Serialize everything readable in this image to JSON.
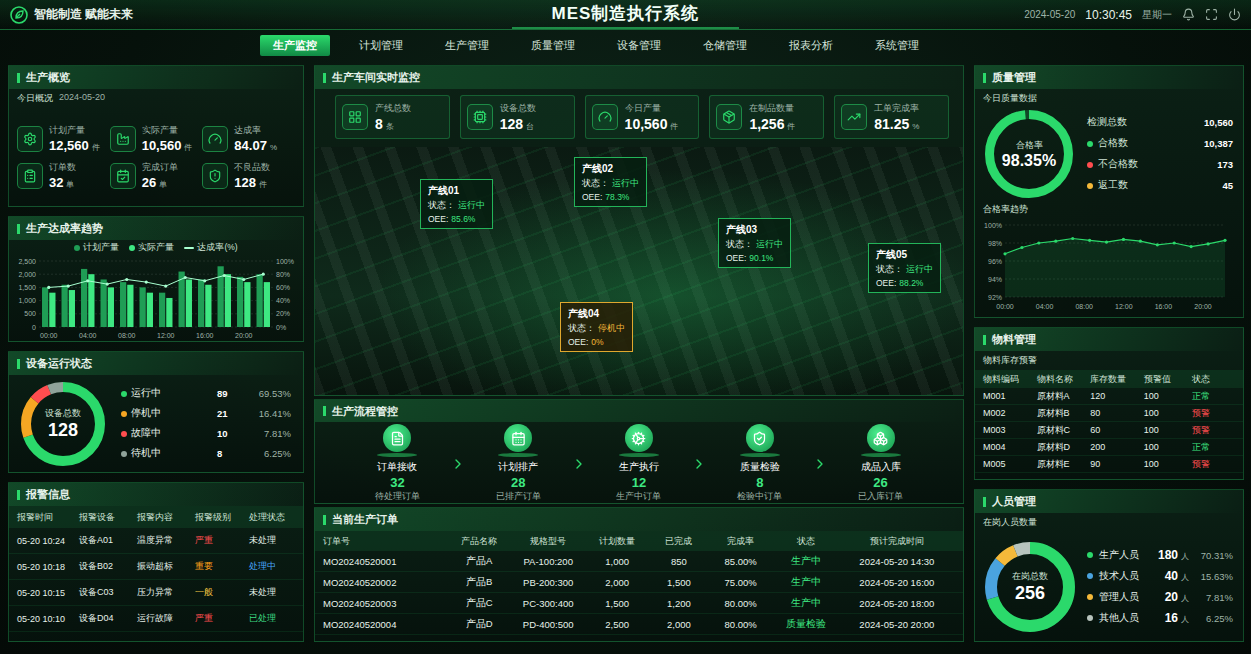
{
  "header": {
    "logo": "智能制造 赋能未来",
    "title": "MES制造执行系统",
    "date": "2024-05-20",
    "time": "10:30:45",
    "weekday": "星期一"
  },
  "nav": [
    {
      "label": "生产监控",
      "selected": true
    },
    {
      "label": "计划管理",
      "selected": false
    },
    {
      "label": "生产管理",
      "selected": false
    },
    {
      "label": "质量管理",
      "selected": false
    },
    {
      "label": "设备管理",
      "selected": false
    },
    {
      "label": "仓储管理",
      "selected": false
    },
    {
      "label": "报表分析",
      "selected": false
    },
    {
      "label": "系统管理",
      "selected": false
    }
  ],
  "overview": {
    "title": "生产概览",
    "subtitle": "今日概况",
    "date": "2024-05-20",
    "stats": [
      {
        "label": "计划产量",
        "value": "12,560",
        "unit": "件"
      },
      {
        "label": "实际产量",
        "value": "10,560",
        "unit": "件"
      },
      {
        "label": "达成率",
        "value": "84.07",
        "unit": "%"
      },
      {
        "label": "订单数",
        "value": "32",
        "unit": "单"
      },
      {
        "label": "完成订单",
        "value": "26",
        "unit": "单"
      },
      {
        "label": "不良品数",
        "value": "128",
        "unit": "件"
      }
    ]
  },
  "trend": {
    "title": "生产达成率趋势",
    "legend": [
      {
        "label": "计划产量",
        "color": "#1f9d55",
        "kind": "bar"
      },
      {
        "label": "实际产量",
        "color": "#3ee882",
        "kind": "bar"
      },
      {
        "label": "达成率(%)",
        "color": "#a8ffd0",
        "kind": "line"
      }
    ],
    "left_ticks": [
      "2,500",
      "2,000",
      "1,500",
      "1,000",
      "500",
      "0"
    ],
    "right_ticks": [
      "100%",
      "80%",
      "60%",
      "40%",
      "20%",
      "0%"
    ],
    "x_ticks": [
      "00:00",
      "04:00",
      "08:00",
      "12:00",
      "16:00",
      "20:00"
    ],
    "plan": [
      1500,
      1600,
      2200,
      1800,
      1700,
      1500,
      1300,
      2100,
      1800,
      2300,
      1900,
      2000
    ],
    "actual": [
      1300,
      1400,
      2000,
      1500,
      1600,
      1300,
      1100,
      1800,
      1600,
      2000,
      1700,
      1700
    ],
    "rate": [
      60,
      62,
      70,
      65,
      72,
      68,
      62,
      75,
      70,
      78,
      72,
      80
    ]
  },
  "equipment": {
    "title": "设备运行状态",
    "center_label": "设备总数",
    "total": "128",
    "items": [
      {
        "label": "运行中",
        "count": "89",
        "percent": "69.53%",
        "color": "#2bd96b"
      },
      {
        "label": "停机中",
        "count": "21",
        "percent": "16.41%",
        "color": "#f5a623"
      },
      {
        "label": "故障中",
        "count": "10",
        "percent": "7.81%",
        "color": "#ff4d4f"
      },
      {
        "label": "待机中",
        "count": "8",
        "percent": "6.25%",
        "color": "#8fa39a"
      }
    ]
  },
  "alarms": {
    "title": "报警信息",
    "columns": [
      "报警时间",
      "报警设备",
      "报警内容",
      "报警级别",
      "处理状态"
    ],
    "rows": [
      {
        "time": "05-20 10:24",
        "device": "设备A01",
        "content": "温度异常",
        "level": "严重",
        "level_color": "#ff4d4f",
        "status": "未处理",
        "status_color": "#e6f2ea"
      },
      {
        "time": "05-20 10:18",
        "device": "设备B02",
        "content": "振动超标",
        "level": "重要",
        "level_color": "#ff9f1a",
        "status": "处理中",
        "status_color": "#4aa8ff"
      },
      {
        "time": "05-20 10:15",
        "device": "设备C03",
        "content": "压力异常",
        "level": "一般",
        "level_color": "#f5c542",
        "status": "未处理",
        "status_color": "#e6f2ea"
      },
      {
        "time": "05-20 10:10",
        "device": "设备D04",
        "content": "运行故障",
        "level": "严重",
        "level_color": "#ff4d4f",
        "status": "已处理",
        "status_color": "#3ddc84"
      }
    ]
  },
  "monitor": {
    "title": "生产车间实时监控",
    "kpis": [
      {
        "label": "产线总数",
        "value": "8",
        "unit": "条"
      },
      {
        "label": "设备总数",
        "value": "128",
        "unit": "台"
      },
      {
        "label": "今日产量",
        "value": "10,560",
        "unit": "件"
      },
      {
        "label": "在制品数量",
        "value": "1,256",
        "unit": "件"
      },
      {
        "label": "工单完成率",
        "value": "81.25",
        "unit": "%"
      }
    ],
    "status_label": "状态：",
    "oee_label": "OEE:",
    "lines": [
      {
        "name": "产线01",
        "status": "运行中",
        "oee": "85.6%",
        "running": true
      },
      {
        "name": "产线02",
        "status": "运行中",
        "oee": "78.3%",
        "running": true
      },
      {
        "name": "产线03",
        "status": "运行中",
        "oee": "90.1%",
        "running": true
      },
      {
        "name": "产线04",
        "status": "停机中",
        "oee": "0%",
        "running": false
      },
      {
        "name": "产线05",
        "status": "运行中",
        "oee": "88.2%",
        "running": true
      }
    ]
  },
  "flow": {
    "title": "生产流程管控",
    "steps": [
      {
        "label": "订单接收",
        "count": "32",
        "caption": "待处理订单"
      },
      {
        "label": "计划排产",
        "count": "28",
        "caption": "已排产订单"
      },
      {
        "label": "生产执行",
        "count": "12",
        "caption": "生产中订单"
      },
      {
        "label": "质量检验",
        "count": "8",
        "caption": "检验中订单"
      },
      {
        "label": "成品入库",
        "count": "26",
        "caption": "已入库订单"
      }
    ]
  },
  "orders": {
    "title": "当前生产订单",
    "columns": [
      "订单号",
      "产品名称",
      "规格型号",
      "计划数量",
      "已完成",
      "完成率",
      "状态",
      "预计完成时间"
    ],
    "rows": [
      {
        "cells": [
          "MO20240520001",
          "产品A",
          "PA-100:200",
          "1,000",
          "850",
          "85.00%"
        ],
        "status": "生产中",
        "status_color": "#3ee882",
        "eta": "2024-05-20 14:30"
      },
      {
        "cells": [
          "MO20240520002",
          "产品B",
          "PB-200:300",
          "2,000",
          "1,500",
          "75.00%"
        ],
        "status": "生产中",
        "status_color": "#3ee882",
        "eta": "2024-05-20 16:00"
      },
      {
        "cells": [
          "MO20240520003",
          "产品C",
          "PC-300:400",
          "1,500",
          "1,200",
          "80.00%"
        ],
        "status": "生产中",
        "status_color": "#3ee882",
        "eta": "2024-05-20 18:00"
      },
      {
        "cells": [
          "MO20240520004",
          "产品D",
          "PD-400:500",
          "2,500",
          "2,000",
          "80.00%"
        ],
        "status": "质量检验",
        "status_color": "#3ee882",
        "eta": "2024-05-20 20:00"
      }
    ]
  },
  "quality": {
    "title": "质量管理",
    "subtitle": "今日质量数据",
    "center_label": "合格率",
    "center_value": "98.35%",
    "level": 0.9835,
    "total": {
      "label": "检测总数",
      "value": "10,560"
    },
    "items": [
      {
        "label": "合格数",
        "value": "10,387",
        "color": "#2bd96b"
      },
      {
        "label": "不合格数",
        "value": "173",
        "color": "#ff4d4f"
      },
      {
        "label": "返工数",
        "value": "45",
        "color": "#f5b93a"
      }
    ],
    "trend_title": "合格率趋势",
    "y_ticks": [
      "100%",
      "98%",
      "96%",
      "94%",
      "92%"
    ],
    "x_ticks": [
      "00:00",
      "04:00",
      "08:00",
      "12:00",
      "16:00",
      "20:00"
    ],
    "values": [
      96.8,
      97.5,
      98.0,
      98.2,
      98.5,
      98.3,
      98.1,
      98.4,
      98.2,
      97.8,
      98.0,
      97.6,
      97.9,
      98.3
    ]
  },
  "materials": {
    "title": "物料管理",
    "subtitle": "物料库存预警",
    "columns": [
      "物料编码",
      "物料名称",
      "库存数量",
      "预警值",
      "状态"
    ],
    "rows": [
      {
        "code": "M001",
        "name": "原材料A",
        "stock": "120",
        "threshold": "100",
        "status": "正常",
        "color": "#3ee882"
      },
      {
        "code": "M002",
        "name": "原材料B",
        "stock": "80",
        "threshold": "100",
        "status": "预警",
        "color": "#ff4d4f"
      },
      {
        "code": "M003",
        "name": "原材料C",
        "stock": "60",
        "threshold": "100",
        "status": "预警",
        "color": "#ff4d4f"
      },
      {
        "code": "M004",
        "name": "原材料D",
        "stock": "200",
        "threshold": "100",
        "status": "正常",
        "color": "#3ee882"
      },
      {
        "code": "M005",
        "name": "原材料E",
        "stock": "90",
        "threshold": "100",
        "status": "预警",
        "color": "#ff4d4f"
      }
    ]
  },
  "personnel": {
    "title": "人员管理",
    "subtitle": "在岗人员数量",
    "center_label": "在岗总数",
    "total": "256",
    "items": [
      {
        "label": "生产人员",
        "count": "180",
        "unit": "人",
        "percent": "70.31%",
        "color": "#2bd96b"
      },
      {
        "label": "技术人员",
        "count": "40",
        "unit": "人",
        "percent": "15.63%",
        "color": "#4aa3df"
      },
      {
        "label": "管理人员",
        "count": "20",
        "unit": "人",
        "percent": "7.81%",
        "color": "#f5b93a"
      },
      {
        "label": "其他人员",
        "count": "16",
        "unit": "人",
        "percent": "6.25%",
        "color": "#b8c4be"
      }
    ]
  }
}
